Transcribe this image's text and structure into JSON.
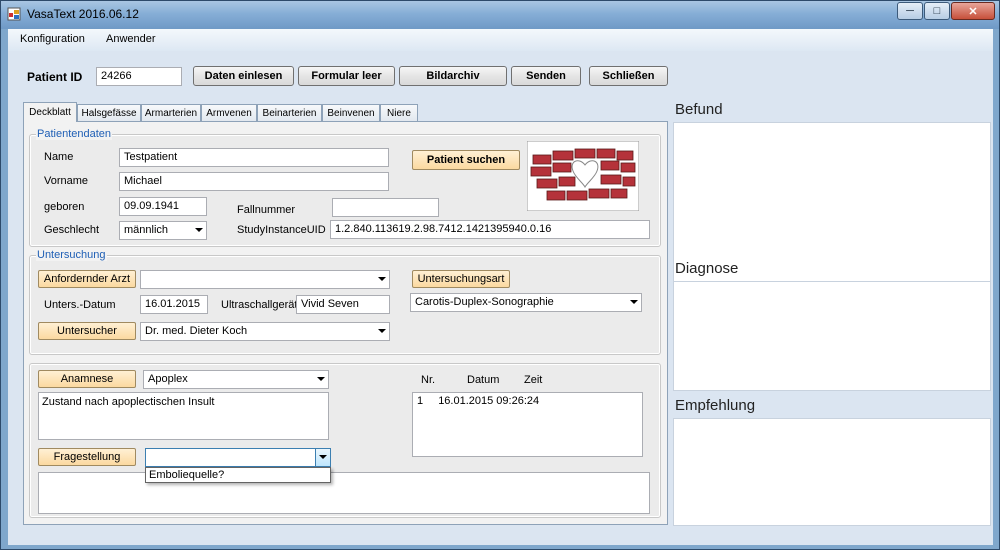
{
  "window": {
    "title": "VasaText  2016.06.12"
  },
  "menu": {
    "items": [
      "Konfiguration",
      "Anwender"
    ]
  },
  "toolbar": {
    "patient_id_label": "Patient ID",
    "patient_id_value": "24266",
    "btn_daten": "Daten einlesen",
    "btn_formular": "Formular leer",
    "btn_bildarchiv": "Bildarchiv",
    "btn_senden": "Senden",
    "btn_schliessen": "Schließen"
  },
  "tabs": [
    "Deckblatt",
    "Halsgefässe",
    "Armarterien",
    "Armvenen",
    "Beinarterien",
    "Beinvenen",
    "Niere"
  ],
  "patient": {
    "group_title": "Patientendaten",
    "name_label": "Name",
    "name_value": "Testpatient",
    "vorname_label": "Vorname",
    "vorname_value": "Michael",
    "geboren_label": "geboren",
    "geboren_value": "09.09.1941",
    "geschlecht_label": "Geschlecht",
    "geschlecht_value": "männlich",
    "fallnummer_label": "Fallnummer",
    "fallnummer_value": "",
    "study_label": "StudyInstanceUID",
    "study_value": "1.2.840.113619.2.98.7412.1421395940.0.16",
    "search_button": "Patient suchen"
  },
  "exam": {
    "group_title": "Untersuchung",
    "anfordernder_button": "Anfordernder Arzt",
    "anfordernder_value": "",
    "datum_label": "Unters.-Datum",
    "datum_value": "16.01.2015",
    "geraet_label": "Ultraschallgerät",
    "geraet_value": "Vivid Seven",
    "untersucher_button": "Untersucher",
    "untersucher_value": "Dr. med. Dieter Koch",
    "art_button": "Untersuchungsart",
    "art_value": "Carotis-Duplex-Sonographie"
  },
  "anamnese": {
    "button": "Anamnese",
    "combo_value": "Apoplex",
    "text": "Zustand nach apoplectischen Insult",
    "frage_button": "Fragestellung",
    "frage_value": "",
    "dropdown_option": "Emboliequelle?",
    "list_headers": {
      "nr": "Nr.",
      "datum": "Datum",
      "zeit": "Zeit"
    },
    "list_rows": [
      {
        "nr": "1",
        "datetime": "16.01.2015 09:26:24"
      }
    ]
  },
  "right_panels": {
    "befund": "Befund",
    "diagnose": "Diagnose",
    "empfehlung": "Empfehlung"
  }
}
